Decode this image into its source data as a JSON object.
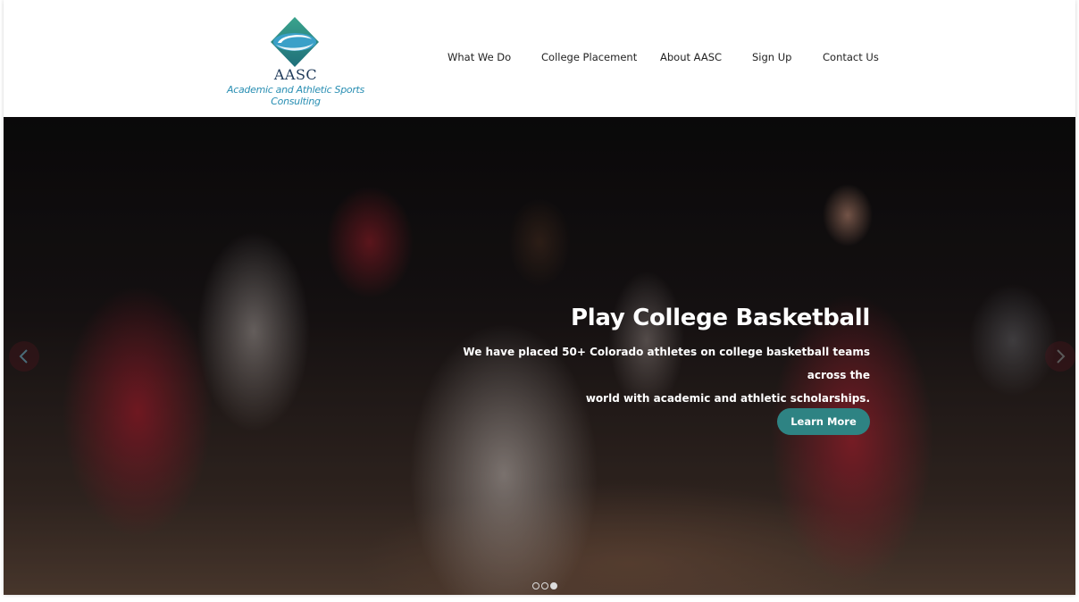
{
  "brand": {
    "name": "AASC",
    "tagline": "Academic and Athletic Sports Consulting",
    "colors": {
      "teal_dark": "#2a7f73",
      "teal_light": "#2a8fb3",
      "navy": "#1f3a5a"
    }
  },
  "nav": {
    "items": [
      {
        "label": "What We Do"
      },
      {
        "label": "College Placement"
      },
      {
        "label": "About AASC"
      },
      {
        "label": "Sign Up"
      },
      {
        "label": "Contact Us"
      }
    ]
  },
  "hero": {
    "title": "Play College Basketball",
    "text_line1": "We have placed 50+ Colorado athletes on college basketball teams across the",
    "text_line2": "world with academic and athletic scholarships.",
    "button_label": "Learn More",
    "button_color": "#2e8383",
    "prev_icon": "chevron-left-icon",
    "next_icon": "chevron-right-icon",
    "slides": {
      "count": 3,
      "active_index": 3
    }
  }
}
